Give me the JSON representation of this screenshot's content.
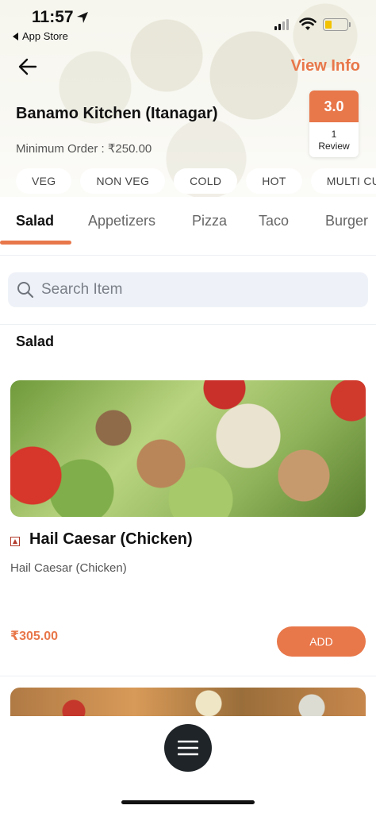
{
  "status_bar": {
    "time": "11:57",
    "back_app_label": "App Store"
  },
  "header": {
    "view_info_label": "View Info",
    "restaurant_name": "Banamo Kitchen (Itanagar)",
    "min_order_text": "Minimum Order : ₹250.00",
    "rating": {
      "score": "3.0",
      "count": "1",
      "count_label": "Review"
    },
    "chips": [
      "VEG",
      "NON VEG",
      "COLD",
      "HOT",
      "MULTI CU"
    ]
  },
  "tabs": [
    {
      "label": "Salad",
      "active": true
    },
    {
      "label": "Appetizers",
      "active": false
    },
    {
      "label": "Pizza",
      "active": false
    },
    {
      "label": "Taco",
      "active": false
    },
    {
      "label": "Burger",
      "active": false
    }
  ],
  "search": {
    "placeholder": "Search Item"
  },
  "section": {
    "title": "Salad"
  },
  "items": [
    {
      "name": "Hail Caesar (Chicken)",
      "description": "Hail Caesar (Chicken)",
      "price": "₹305.00",
      "add_label": "ADD",
      "type": "non-veg"
    }
  ],
  "colors": {
    "accent": "#e8774a",
    "fab": "#1f2428",
    "search_bg": "#eef2f8"
  },
  "icons": {
    "back": "arrow-left-icon",
    "search": "search-icon",
    "menu": "hamburger-menu-icon",
    "location": "location-arrow-icon"
  }
}
